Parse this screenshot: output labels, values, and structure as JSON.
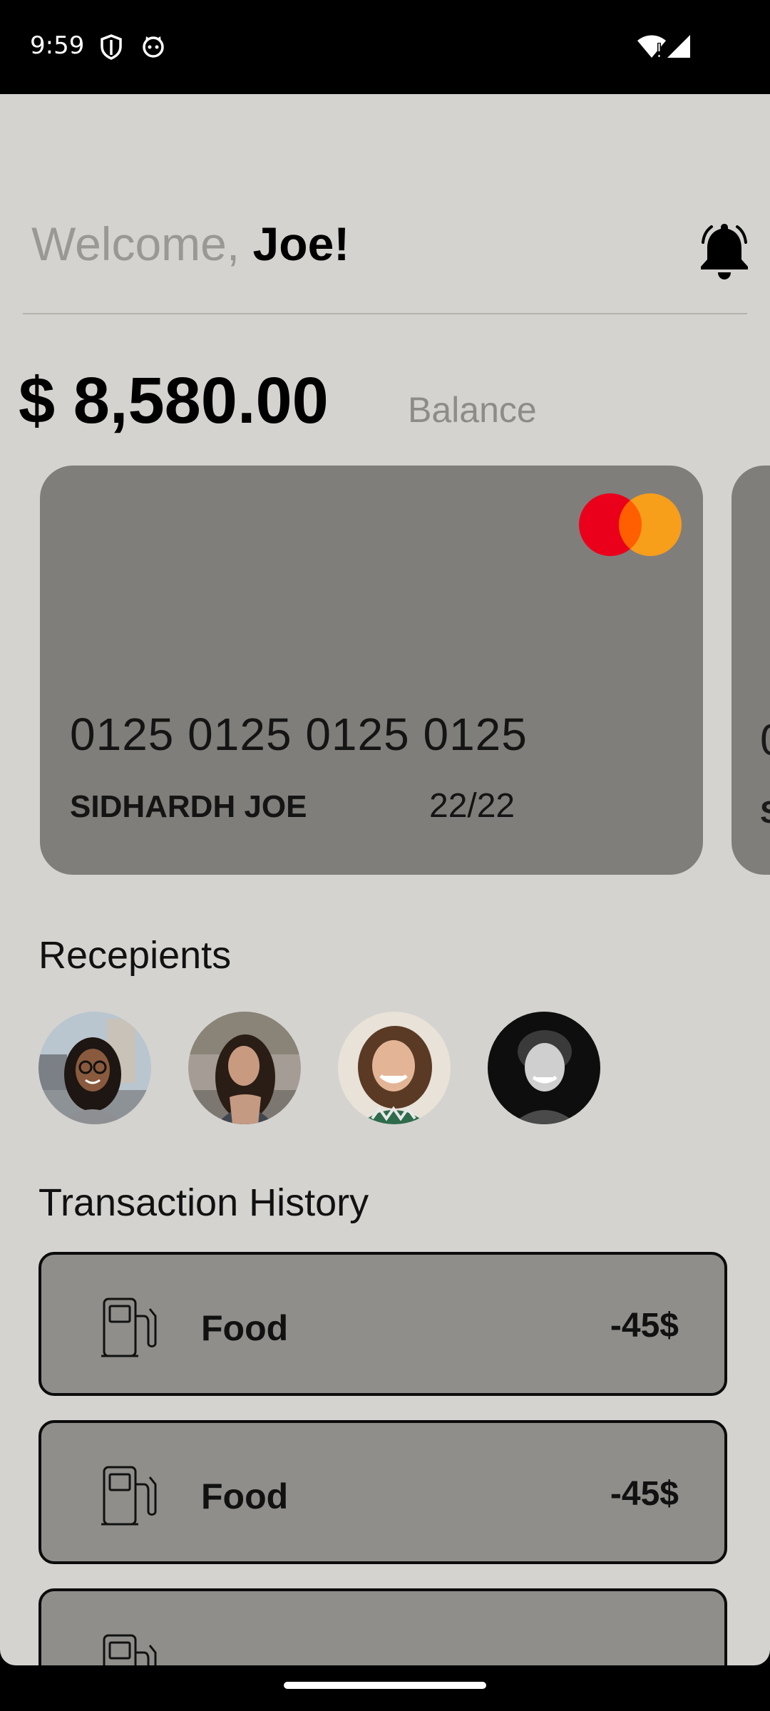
{
  "status_bar": {
    "time": "9:59",
    "icons": [
      "shield-icon",
      "cat-face-icon",
      "wifi-alert-icon",
      "cell-signal-icon"
    ]
  },
  "header": {
    "welcome_prefix": "Welcome, ",
    "user_name": "Joe!",
    "notification_icon": "bell-icon"
  },
  "balance": {
    "amount": "$ 8,580.00",
    "label": "Balance"
  },
  "card": {
    "number": "0125 0125 0125 0125",
    "holder": "SIDHARDH JOE",
    "expiry": "22/22",
    "brand_icon": "mastercard-logo",
    "peek_number": "0",
    "peek_name": "S"
  },
  "recipients": {
    "title": "Recepients",
    "avatars": [
      "recipient-1",
      "recipient-2",
      "recipient-3",
      "recipient-4"
    ]
  },
  "transactions": {
    "title": "Transaction History",
    "items": [
      {
        "icon": "fuel-pump-icon",
        "label": "Food",
        "amount": "-45$"
      },
      {
        "icon": "fuel-pump-icon",
        "label": "Food",
        "amount": "-45$"
      },
      {
        "icon": "fuel-pump-icon",
        "label": "",
        "amount": ""
      }
    ]
  },
  "colors": {
    "background": "#d4d3cf",
    "card": "#807e7a",
    "transaction": "#8f8e8a",
    "mastercard_red": "#eb001b",
    "mastercard_orange": "#f79e1b"
  }
}
